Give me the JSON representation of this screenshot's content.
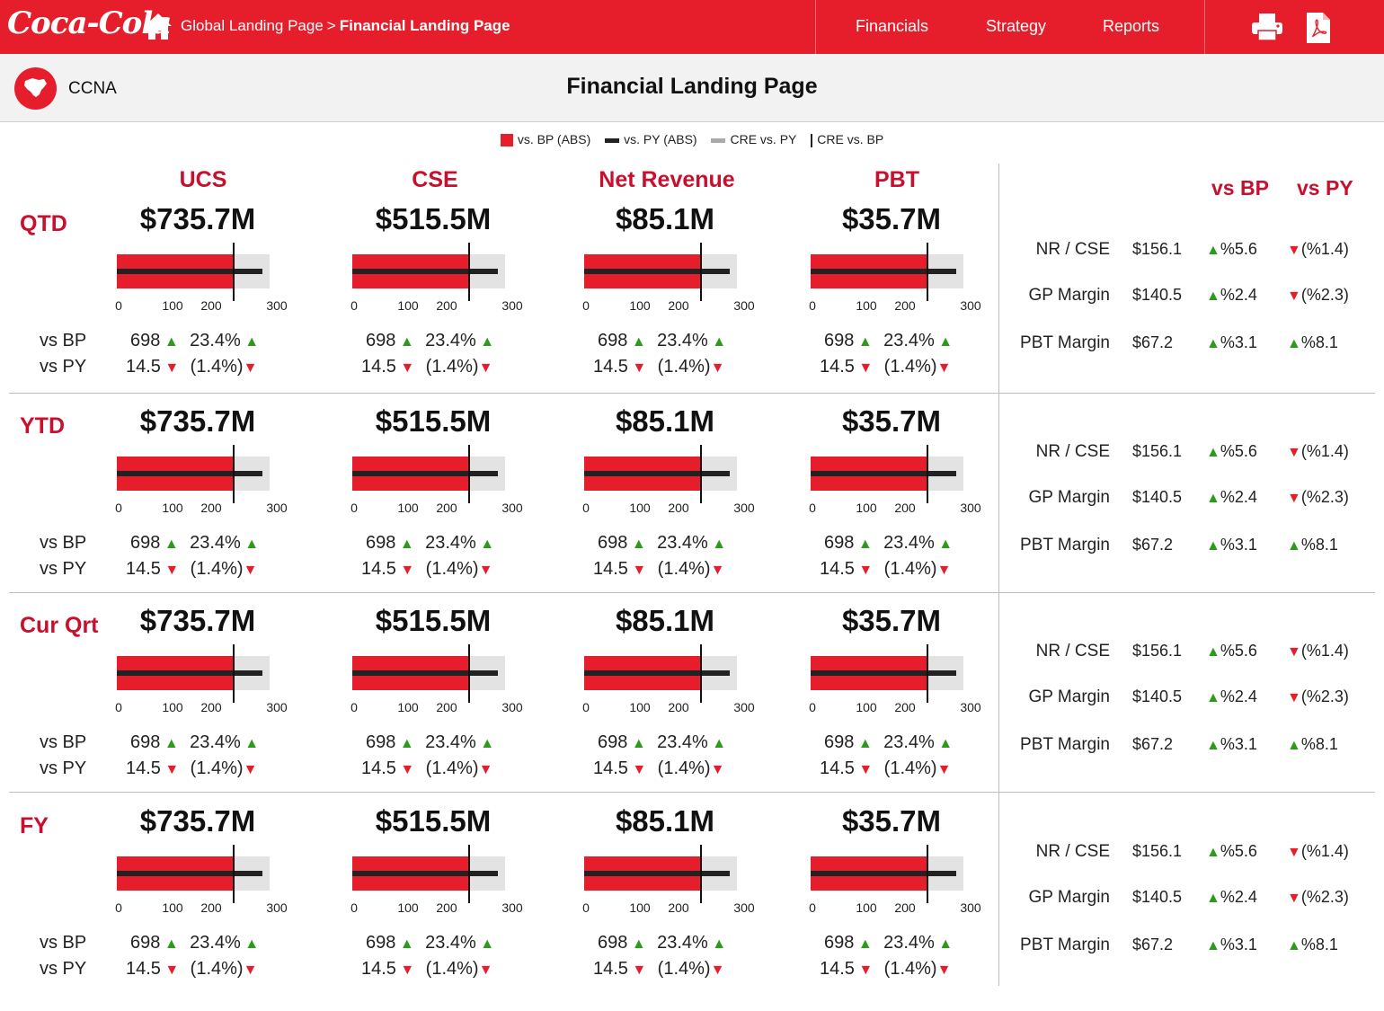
{
  "header": {
    "logo_text": "Coca-Cola",
    "breadcrumb_home": "Global Landing Page",
    "breadcrumb_sep": ">",
    "breadcrumb_current": "Financial Landing Page",
    "nav": [
      "Financials",
      "Strategy",
      "Reports"
    ],
    "colors": {
      "brand_red": "#e61e2b",
      "up_green": "#2e9a1c",
      "title_red": "#c8102e"
    }
  },
  "subheader": {
    "region": "CCNA",
    "title": "Financial Landing Page"
  },
  "legend": [
    {
      "label": "vs. BP (ABS)",
      "swatch": "red-square"
    },
    {
      "label": "vs. PY (ABS)",
      "swatch": "black-bar"
    },
    {
      "label": "CRE vs. PY",
      "swatch": "grey-bar"
    },
    {
      "label": "CRE vs. BP",
      "swatch": "vertical-line"
    }
  ],
  "columns": [
    "UCS",
    "CSE",
    "Net Revenue",
    "PBT"
  ],
  "right_headers": {
    "vs_bp": "vs BP",
    "vs_py": "vs PY"
  },
  "row_labels": {
    "vs_bp": "vs BP",
    "vs_py": "vs PY"
  },
  "axis_ticks": [
    "0",
    "100",
    "200",
    "300"
  ],
  "sections": [
    {
      "period": "QTD",
      "metrics": [
        {
          "value": "$735.7M",
          "red": 200,
          "black": 245,
          "grey": 275,
          "marker": 200,
          "bp_abs": "698",
          "bp_pct": "23.4%",
          "py_abs": "14.5",
          "py_pct": "(1.4%)"
        },
        {
          "value": "$515.5M",
          "red": 200,
          "black": 245,
          "grey": 275,
          "marker": 200,
          "bp_abs": "698",
          "bp_pct": "23.4%",
          "py_abs": "14.5",
          "py_pct": "(1.4%)"
        },
        {
          "value": "$85.1M",
          "red": 200,
          "black": 245,
          "grey": 275,
          "marker": 200,
          "bp_abs": "698",
          "bp_pct": "23.4%",
          "py_abs": "14.5",
          "py_pct": "(1.4%)"
        },
        {
          "value": "$35.7M",
          "red": 200,
          "black": 245,
          "grey": 275,
          "marker": 200,
          "bp_abs": "698",
          "bp_pct": "23.4%",
          "py_abs": "14.5",
          "py_pct": "(1.4%)"
        }
      ],
      "kpis": [
        {
          "label": "NR / CSE",
          "value": "$156.1",
          "vs_bp": "%5.6",
          "bp_dir": "up",
          "vs_py": "(%1.4)",
          "py_dir": "down"
        },
        {
          "label": "GP Margin",
          "value": "$140.5",
          "vs_bp": "%2.4",
          "bp_dir": "up",
          "vs_py": "(%2.3)",
          "py_dir": "down"
        },
        {
          "label": "PBT Margin",
          "value": "$67.2",
          "vs_bp": "%3.1",
          "bp_dir": "up",
          "vs_py": "%8.1",
          "py_dir": "up"
        }
      ]
    },
    {
      "period": "YTD",
      "metrics": [
        {
          "value": "$735.7M",
          "red": 200,
          "black": 245,
          "grey": 275,
          "marker": 200,
          "bp_abs": "698",
          "bp_pct": "23.4%",
          "py_abs": "14.5",
          "py_pct": "(1.4%)"
        },
        {
          "value": "$515.5M",
          "red": 200,
          "black": 245,
          "grey": 275,
          "marker": 200,
          "bp_abs": "698",
          "bp_pct": "23.4%",
          "py_abs": "14.5",
          "py_pct": "(1.4%)"
        },
        {
          "value": "$85.1M",
          "red": 200,
          "black": 245,
          "grey": 275,
          "marker": 200,
          "bp_abs": "698",
          "bp_pct": "23.4%",
          "py_abs": "14.5",
          "py_pct": "(1.4%)"
        },
        {
          "value": "$35.7M",
          "red": 200,
          "black": 245,
          "grey": 275,
          "marker": 200,
          "bp_abs": "698",
          "bp_pct": "23.4%",
          "py_abs": "14.5",
          "py_pct": "(1.4%)"
        }
      ],
      "kpis": [
        {
          "label": "NR / CSE",
          "value": "$156.1",
          "vs_bp": "%5.6",
          "bp_dir": "up",
          "vs_py": "(%1.4)",
          "py_dir": "down"
        },
        {
          "label": "GP Margin",
          "value": "$140.5",
          "vs_bp": "%2.4",
          "bp_dir": "up",
          "vs_py": "(%2.3)",
          "py_dir": "down"
        },
        {
          "label": "PBT Margin",
          "value": "$67.2",
          "vs_bp": "%3.1",
          "bp_dir": "up",
          "vs_py": "%8.1",
          "py_dir": "up"
        }
      ]
    },
    {
      "period": "Cur Qrt",
      "metrics": [
        {
          "value": "$735.7M",
          "red": 200,
          "black": 245,
          "grey": 275,
          "marker": 200,
          "bp_abs": "698",
          "bp_pct": "23.4%",
          "py_abs": "14.5",
          "py_pct": "(1.4%)"
        },
        {
          "value": "$515.5M",
          "red": 200,
          "black": 245,
          "grey": 275,
          "marker": 200,
          "bp_abs": "698",
          "bp_pct": "23.4%",
          "py_abs": "14.5",
          "py_pct": "(1.4%)"
        },
        {
          "value": "$85.1M",
          "red": 200,
          "black": 245,
          "grey": 275,
          "marker": 200,
          "bp_abs": "698",
          "bp_pct": "23.4%",
          "py_abs": "14.5",
          "py_pct": "(1.4%)"
        },
        {
          "value": "$35.7M",
          "red": 200,
          "black": 245,
          "grey": 275,
          "marker": 200,
          "bp_abs": "698",
          "bp_pct": "23.4%",
          "py_abs": "14.5",
          "py_pct": "(1.4%)"
        }
      ],
      "kpis": [
        {
          "label": "NR / CSE",
          "value": "$156.1",
          "vs_bp": "%5.6",
          "bp_dir": "up",
          "vs_py": "(%1.4)",
          "py_dir": "down"
        },
        {
          "label": "GP Margin",
          "value": "$140.5",
          "vs_bp": "%2.4",
          "bp_dir": "up",
          "vs_py": "(%2.3)",
          "py_dir": "down"
        },
        {
          "label": "PBT Margin",
          "value": "$67.2",
          "vs_bp": "%3.1",
          "bp_dir": "up",
          "vs_py": "%8.1",
          "py_dir": "up"
        }
      ]
    },
    {
      "period": "FY",
      "metrics": [
        {
          "value": "$735.7M",
          "red": 200,
          "black": 245,
          "grey": 275,
          "marker": 200,
          "bp_abs": "698",
          "bp_pct": "23.4%",
          "py_abs": "14.5",
          "py_pct": "(1.4%)"
        },
        {
          "value": "$515.5M",
          "red": 200,
          "black": 245,
          "grey": 275,
          "marker": 200,
          "bp_abs": "698",
          "bp_pct": "23.4%",
          "py_abs": "14.5",
          "py_pct": "(1.4%)"
        },
        {
          "value": "$85.1M",
          "red": 200,
          "black": 245,
          "grey": 275,
          "marker": 200,
          "bp_abs": "698",
          "bp_pct": "23.4%",
          "py_abs": "14.5",
          "py_pct": "(1.4%)"
        },
        {
          "value": "$35.7M",
          "red": 200,
          "black": 245,
          "grey": 275,
          "marker": 200,
          "bp_abs": "698",
          "bp_pct": "23.4%",
          "py_abs": "14.5",
          "py_pct": "(1.4%)"
        }
      ],
      "kpis": [
        {
          "label": "NR / CSE",
          "value": "$156.1",
          "vs_bp": "%5.6",
          "bp_dir": "up",
          "vs_py": "(%1.4)",
          "py_dir": "down"
        },
        {
          "label": "GP Margin",
          "value": "$140.5",
          "vs_bp": "%2.4",
          "bp_dir": "up",
          "vs_py": "(%2.3)",
          "py_dir": "down"
        },
        {
          "label": "PBT Margin",
          "value": "$67.2",
          "vs_bp": "%3.1",
          "bp_dir": "up",
          "vs_py": "%8.1",
          "py_dir": "up"
        }
      ]
    }
  ]
}
